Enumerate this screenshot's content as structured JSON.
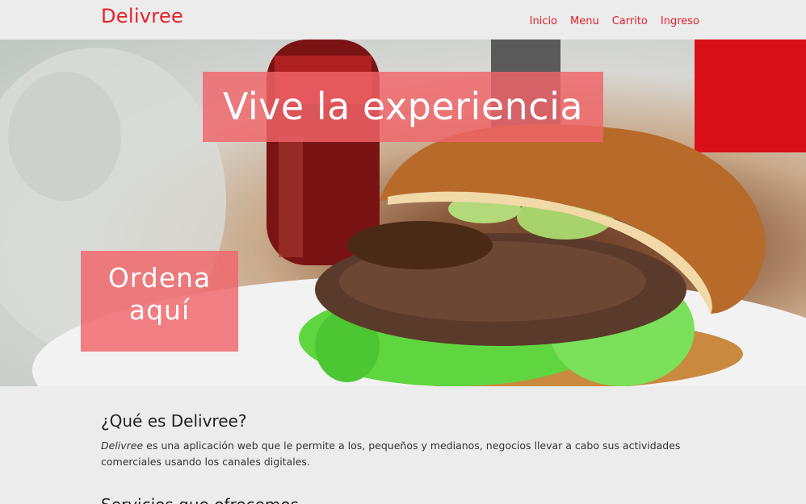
{
  "navbar": {
    "brand": "Delivree",
    "links": [
      "Inicio",
      "Menu",
      "Carrito",
      "Ingreso"
    ]
  },
  "hero": {
    "headline": "Vive la experiencia",
    "cta_line1": "Ordena",
    "cta_line2": "aquí"
  },
  "about": {
    "title": "¿Qué es Delivree?",
    "brand_italic": "Delivree",
    "text_line1": " es una aplicación web que le permite a los, pequeños y medianos, negocios llevar a cabo sus actividades",
    "text_line2": "comerciales usando los canales digitales."
  },
  "next_section": {
    "title_partial": "Servicios que ofrecemos"
  },
  "colors": {
    "accent": "#e8202a",
    "overlay": "#f06469",
    "background": "#ececec"
  },
  "icons": {
    "hero_image": "burger-photo"
  }
}
